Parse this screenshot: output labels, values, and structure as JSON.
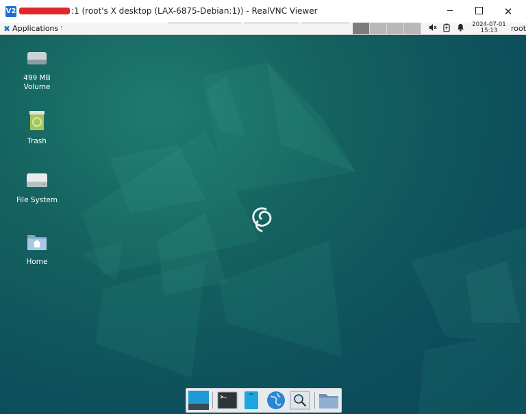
{
  "window": {
    "title": ":1 (root's X desktop (LAX-6875-Debian:1)) - RealVNC Viewer",
    "minimize_label": "─",
    "close_label": "✕"
  },
  "panel": {
    "applications_label": "Applications",
    "clock_date": "2024-07-01",
    "clock_time": "15:13",
    "user": "root"
  },
  "desktop_icons": [
    {
      "label_line1": "499 MB",
      "label_line2": "Volume",
      "icon": "drive-icon"
    },
    {
      "label_line1": "Trash",
      "icon": "trash-icon"
    },
    {
      "label_line1": "File System",
      "icon": "filesystem-drive-icon"
    },
    {
      "label_line1": "Home",
      "icon": "home-folder-icon"
    }
  ],
  "dock_items": [
    {
      "name": "show-desktop",
      "icon": "show-desktop-icon"
    },
    {
      "name": "terminal",
      "icon": "terminal-icon"
    },
    {
      "name": "file-manager",
      "icon": "file-manager-icon"
    },
    {
      "name": "web-browser",
      "icon": "web-browser-icon"
    },
    {
      "name": "app-finder",
      "icon": "app-finder-icon"
    },
    {
      "name": "folder",
      "icon": "folder-icon"
    }
  ],
  "colors": {
    "accent": "#1f6fd6",
    "desktop_bg": "#0d4f5c",
    "desktop_glow": "#1f7b6e"
  }
}
